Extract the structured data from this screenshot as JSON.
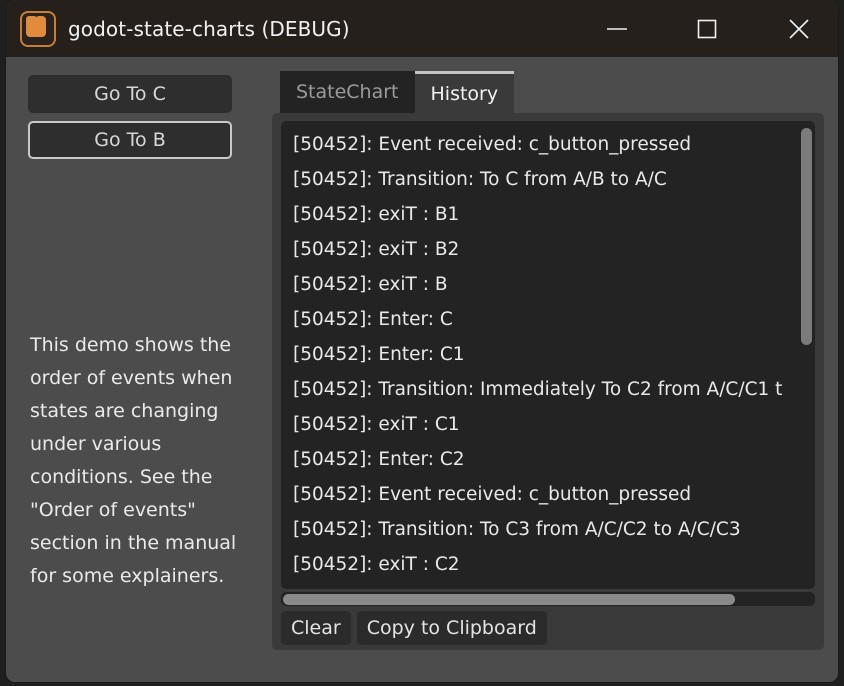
{
  "window": {
    "title": "godot-state-charts (DEBUG)",
    "icon": "godot-state-charts-app-icon",
    "controls": {
      "minimize": "minimize-icon",
      "maximize": "maximize-icon",
      "close": "close-icon"
    }
  },
  "left_panel": {
    "buttons": [
      {
        "label": "Go To C",
        "focused": false
      },
      {
        "label": "Go To B",
        "focused": true
      }
    ],
    "description": "This demo shows the order of events when states are changing under various conditions. See the \"Order of events\" section in the manual for some explainers."
  },
  "right_panel": {
    "tabs": [
      {
        "label": "StateChart",
        "active": false
      },
      {
        "label": "History",
        "active": true
      }
    ],
    "log_lines": [
      "[50452]: Event received: c_button_pressed",
      "[50452]: Transition: To C from A/B to A/C",
      "[50452]: exiT : B1",
      "[50452]: exiT : B2",
      "[50452]: exiT : B",
      "[50452]: Enter: C",
      "[50452]: Enter: C1",
      "[50452]: Transition: Immediately To C2 from A/C/C1 t",
      "[50452]: exiT : C1",
      "[50452]: Enter: C2",
      "[50452]: Event received: c_button_pressed",
      "[50452]: Transition: To C3 from A/C/C2 to A/C/C3",
      "[50452]: exiT : C2"
    ],
    "actions": [
      {
        "label": "Clear"
      },
      {
        "label": "Copy to Clipboard"
      }
    ]
  },
  "colors": {
    "titlebar_bg": "#26201d",
    "window_bg": "#4c4c4c",
    "panel_bg": "#3a3a3a",
    "log_bg": "#232323",
    "accent_orange": "#e08c3c",
    "tab_active_accent": "#c2c2c2"
  }
}
